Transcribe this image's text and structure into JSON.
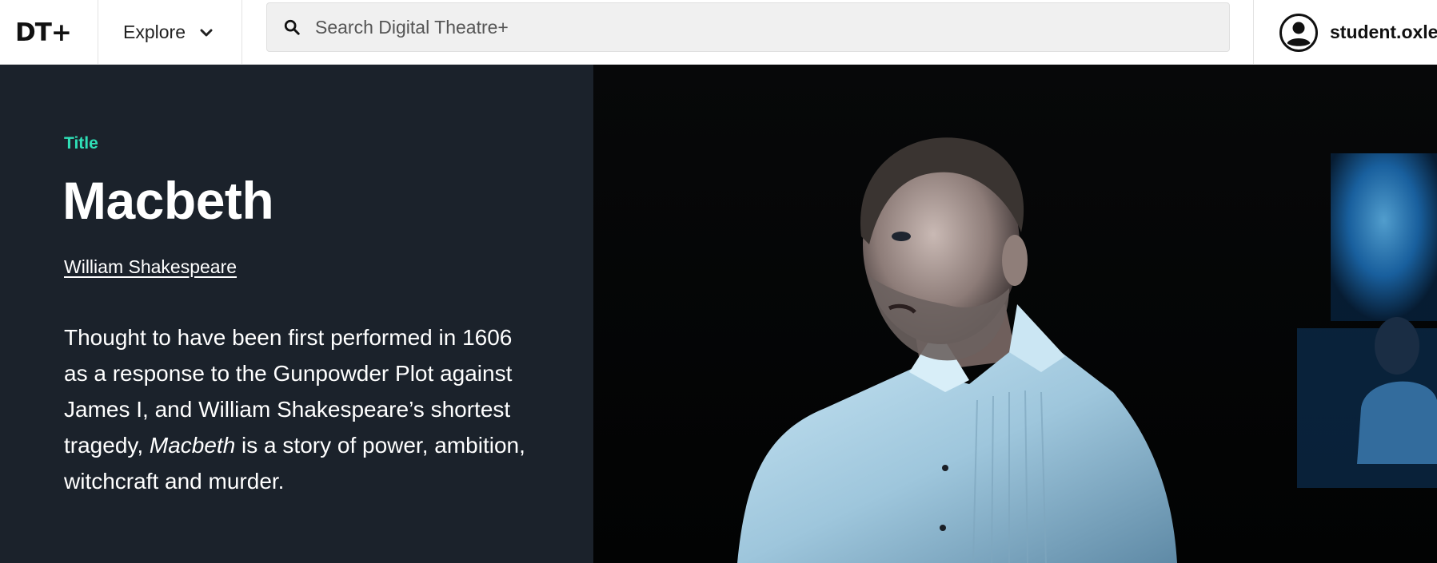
{
  "header": {
    "logo": "DT+",
    "explore_label": "Explore",
    "search_placeholder": "Search Digital Theatre+",
    "user_name": "student.oxle"
  },
  "hero": {
    "kind": "Title",
    "title": "Macbeth",
    "author": "William Shakespeare",
    "description_before": "Thought to have been first performed in 1606 as a response to the Gunpowder Plot against James I, and William Shakespeare’s shortest tragedy, ",
    "description_italic": "Macbeth",
    "description_after": " is a story of power, ambition, witchcraft and murder."
  },
  "icons": {
    "search": "search-icon",
    "explore": "chevron-down-icon",
    "user": "user-circle-icon"
  },
  "colors": {
    "accent": "#2fe0b7",
    "hero_background": "#1b222b"
  }
}
